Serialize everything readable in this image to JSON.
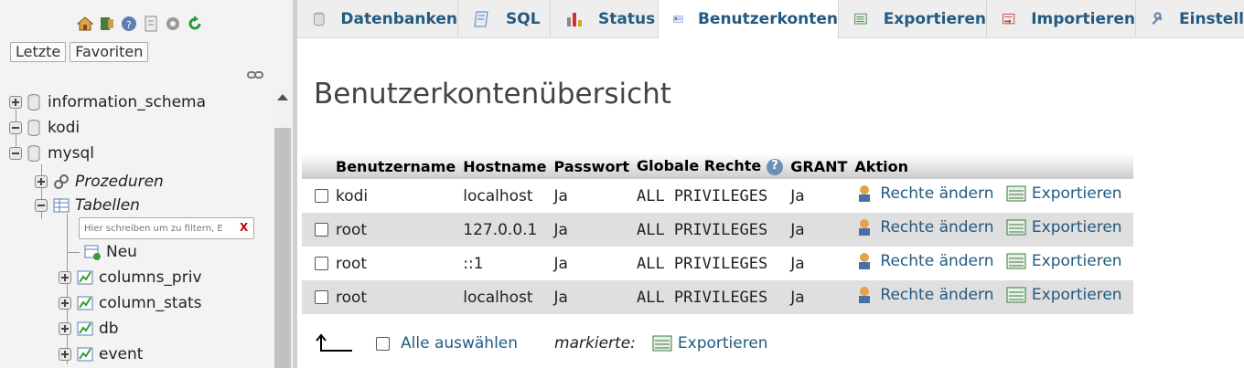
{
  "nav": {
    "tabs": [
      "Letzte",
      "Favoriten"
    ],
    "databases": [
      {
        "name": "information_schema",
        "expanded": false
      },
      {
        "name": "kodi",
        "expanded": true
      },
      {
        "name": "mysql",
        "expanded": true
      }
    ],
    "mysql_children": [
      {
        "name": "Prozeduren",
        "italic": true
      },
      {
        "name": "Tabellen",
        "italic": true
      }
    ],
    "filter_placeholder": "Hier schreiben um zu filtern, E",
    "filter_clear": "X",
    "tables": [
      "Neu",
      "columns_priv",
      "column_stats",
      "db",
      "event"
    ]
  },
  "topbar": {
    "tabs": [
      {
        "label": "Datenbanken",
        "icon": "database-icon"
      },
      {
        "label": "SQL",
        "icon": "sql-icon"
      },
      {
        "label": "Status",
        "icon": "status-chart-icon"
      },
      {
        "label": "Benutzerkonten",
        "icon": "user-accounts-icon",
        "active": true
      },
      {
        "label": "Exportieren",
        "icon": "export-icon"
      },
      {
        "label": "Importieren",
        "icon": "import-icon"
      },
      {
        "label": "Einstell",
        "icon": "wrench-icon"
      }
    ]
  },
  "main": {
    "title": "Benutzerkontenübersicht",
    "columns": [
      "Benutzername",
      "Hostname",
      "Passwort",
      "Globale Rechte",
      "GRANT",
      "Aktion"
    ],
    "rows": [
      {
        "user": "kodi",
        "host": "localhost",
        "password": "Ja",
        "privileges": "ALL PRIVILEGES",
        "grant": "Ja"
      },
      {
        "user": "root",
        "host": "127.0.0.1",
        "password": "Ja",
        "privileges": "ALL PRIVILEGES",
        "grant": "Ja"
      },
      {
        "user": "root",
        "host": "::1",
        "password": "Ja",
        "privileges": "ALL PRIVILEGES",
        "grant": "Ja"
      },
      {
        "user": "root",
        "host": "localhost",
        "password": "Ja",
        "privileges": "ALL PRIVILEGES",
        "grant": "Ja"
      }
    ],
    "actions": {
      "edit": "Rechte ändern",
      "export": "Exportieren"
    },
    "footer": {
      "select_all": "Alle auswählen",
      "marked": "markierte:",
      "export": "Exportieren"
    }
  },
  "colors": {
    "link": "#235a81",
    "nav_bg": "#f3f3f3",
    "row_alt": "#dfdfdf"
  }
}
